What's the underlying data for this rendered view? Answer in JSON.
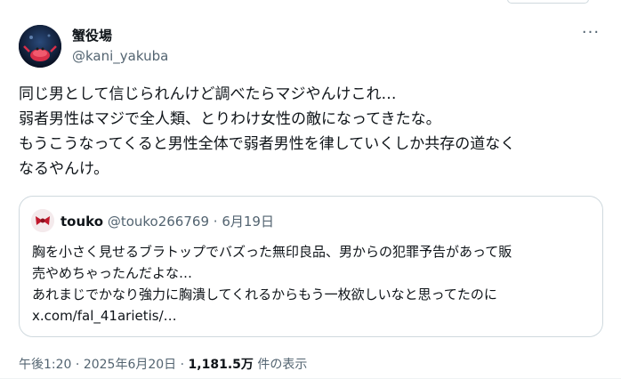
{
  "tweet": {
    "author": {
      "display_name": "蟹役場",
      "handle": "@kani_yakuba"
    },
    "more_label": "···",
    "text": "同じ男として信じられんけど調べたらマジやんけこれ…\n弱者男性はマジで全人類、とりわけ女性の敵になってきたな。\nもうこうなってくると男性全体で弱者男性を律していくしか共存の道なく\nなるやんけ。"
  },
  "quote": {
    "author": {
      "display_name": "touko",
      "handle": "@touko266769"
    },
    "separator": "·",
    "date": "6月19日",
    "text": "胸を小さく見せるブラトップでバズった無印良品、男からの犯罪予告があって販\n売やめちゃったんだよな…\nあれまじでかなり強力に胸潰してくれるからもう一枚欲しいなと思ってたのに\nx.com/fal_41arietis/…"
  },
  "meta": {
    "time": "午後1:20",
    "separator": "·",
    "date": "2025年6月20日",
    "views_count": "1,181.5万",
    "views_label": "件の表示"
  },
  "icons": {
    "author_avatar": "crab-avatar-icon",
    "quote_avatar": "ribbon-avatar-icon",
    "more": "more-options-icon"
  }
}
